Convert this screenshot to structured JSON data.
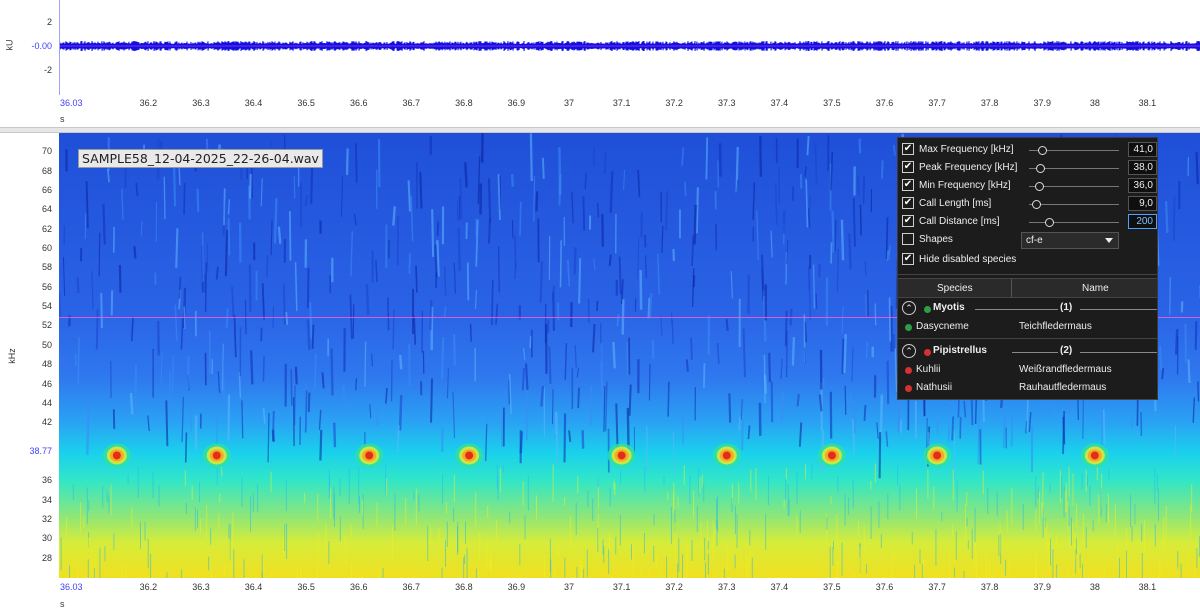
{
  "waveform": {
    "y_unit": "kU",
    "y_ticks": [
      "2",
      "-0.00",
      "-2"
    ],
    "x_unit": "s",
    "x_first": "36.03",
    "x_ticks": [
      "36.2",
      "36.3",
      "36.4",
      "36.5",
      "36.6",
      "36.7",
      "36.8",
      "36.9",
      "37",
      "37.1",
      "37.2",
      "37.3",
      "37.4",
      "37.5",
      "37.6",
      "37.7",
      "37.8",
      "37.9",
      "38",
      "38.1"
    ]
  },
  "spectrogram": {
    "file_name": "SAMPLE58_12-04-2025_22-26-04.wav",
    "y_unit": "kHz",
    "y_ticks": [
      "70",
      "68",
      "66",
      "64",
      "62",
      "60",
      "58",
      "56",
      "54",
      "52",
      "50",
      "48",
      "46",
      "44",
      "42",
      "36",
      "34",
      "32",
      "30",
      "28"
    ],
    "cursor_value": "38.77",
    "x_unit": "s",
    "x_first": "36.03",
    "x_ticks": [
      "36.2",
      "36.3",
      "36.4",
      "36.5",
      "36.6",
      "36.7",
      "36.8",
      "36.9",
      "37",
      "37.1",
      "37.2",
      "37.3",
      "37.4",
      "37.5",
      "37.6",
      "37.7",
      "37.8",
      "37.9",
      "38",
      "38.1"
    ],
    "crosshair_color": "#ff57d8",
    "call_times_s": [
      36.14,
      36.33,
      36.62,
      36.81,
      37.1,
      37.3,
      37.5,
      37.7,
      38.0
    ]
  },
  "filter_panel": {
    "filters": [
      {
        "label": "Max Frequency [kHz]",
        "checked": true,
        "value": "41,0",
        "slider": 0.12
      },
      {
        "label": "Peak Frequency [kHz]",
        "checked": true,
        "value": "38,0",
        "slider": 0.1
      },
      {
        "label": "Min Frequency [kHz]",
        "checked": true,
        "value": "36,0",
        "slider": 0.09
      },
      {
        "label": "Call Length [ms]",
        "checked": true,
        "value": "9,0",
        "slider": 0.06
      },
      {
        "label": "Call Distance [ms]",
        "checked": true,
        "value": "200",
        "slider": 0.2
      }
    ],
    "shapes": {
      "label": "Shapes",
      "checked": false,
      "value": "cf-e"
    },
    "hide_disabled": {
      "label": "Hide disabled species",
      "checked": true
    },
    "table": {
      "col_species": "Species",
      "col_name": "Name",
      "groups": [
        {
          "name": "Myotis",
          "count": "(1)",
          "color": "#2ea043",
          "species": [
            {
              "species": "Dasycneme",
              "name": "Teichfledermaus"
            }
          ]
        },
        {
          "name": "Pipistrellus",
          "count": "(2)",
          "color": "#d93030",
          "species": [
            {
              "species": "Kuhlii",
              "name": "Weißrandfledermaus"
            },
            {
              "species": "Nathusii",
              "name": "Rauhautfledermaus"
            }
          ]
        }
      ]
    }
  }
}
